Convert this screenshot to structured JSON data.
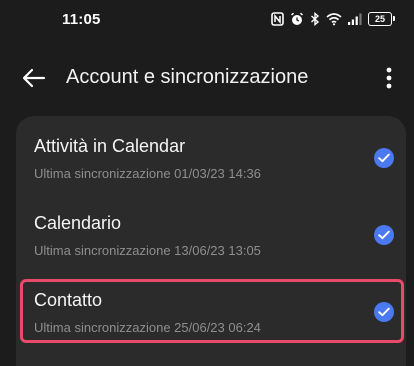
{
  "status_bar": {
    "time": "11:05",
    "battery_level": "25",
    "icons": [
      "nfc-icon",
      "alarm-icon",
      "bluetooth-icon",
      "wifi-icon",
      "signal-icon",
      "battery-icon"
    ]
  },
  "app_bar": {
    "title": "Account e sincronizzazione",
    "back_icon": "arrow-left-icon",
    "menu_icon": "more-vertical-icon"
  },
  "sync_items": [
    {
      "title": "Attività in Calendar",
      "subtitle": "Ultima sincronizzazione 01/03/23 14:36",
      "checked": true
    },
    {
      "title": "Calendario",
      "subtitle": "Ultima sincronizzazione 13/06/23 13:05",
      "checked": true
    },
    {
      "title": "Contatto",
      "subtitle": "Ultima sincronizzazione 25/06/23 06:24",
      "checked": true,
      "highlighted": true
    }
  ],
  "colors": {
    "background": "#1c1c1c",
    "card": "#2b2b2b",
    "accent": "#4a79f2",
    "highlight": "#e84a6a",
    "subtitle": "#8e8e8e"
  }
}
